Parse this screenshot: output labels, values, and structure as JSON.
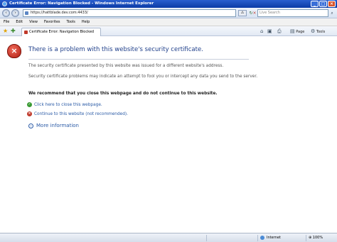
{
  "window": {
    "title": "Certificate Error: Navigation Blocked - Windows Internet Explorer",
    "controls": [
      "_",
      "□",
      "×"
    ]
  },
  "navbar": {
    "address": "https://hattblade.dev.com:4433/",
    "search_placeholder": "Live Search"
  },
  "menu": {
    "items": [
      "File",
      "Edit",
      "View",
      "Favorites",
      "Tools",
      "Help"
    ]
  },
  "favorites_bar": {
    "tab_title": "Certificate Error: Navigation Blocked",
    "commands": [
      "Page",
      "Tools"
    ]
  },
  "content": {
    "headline": "There is a problem with this website's security certificate.",
    "para1": "The security certificate presented by this website was issued for a different website's address.",
    "para2": "Security certificate problems may indicate an attempt to fool you or intercept any data you send to the server.",
    "recommendation": "We recommend that you close this webpage and do not continue to this website.",
    "option_close": "Click here to close this webpage.",
    "option_continue": "Continue to this website (not recommended).",
    "more_info": "More information"
  },
  "statusbar": {
    "zone": "Internet",
    "zoom": "100%"
  },
  "colors": {
    "titlebar": "#0b3ba6",
    "headline": "#1f3f8a",
    "link": "#2a5aa6",
    "shield": "#b01e12"
  }
}
